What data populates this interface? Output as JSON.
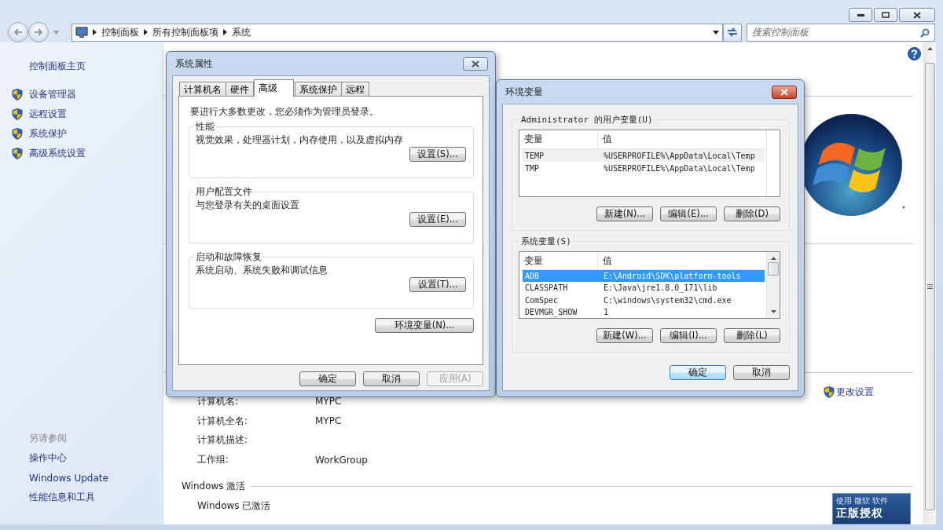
{
  "address_bar": {
    "crumbs": [
      "控制面板",
      "所有控制面板项",
      "系统"
    ]
  },
  "search": {
    "placeholder": "搜索控制面板"
  },
  "sidebar": {
    "home": "控制面板主页",
    "items": [
      {
        "label": "设备管理器"
      },
      {
        "label": "远程设置"
      },
      {
        "label": "系统保护"
      },
      {
        "label": "高级系统设置"
      }
    ],
    "see_also": {
      "title": "另请参阅",
      "links": [
        "操作中心",
        "Windows Update",
        "性能信息和工具"
      ]
    }
  },
  "computer": {
    "change_settings": "更改设置",
    "rows": [
      {
        "label": "计算机名:",
        "value": "MYPC"
      },
      {
        "label": "计算机全名:",
        "value": "MYPC"
      },
      {
        "label": "计算机描述:"
      },
      {
        "label": "工作组:",
        "value": "WorkGroup"
      }
    ]
  },
  "activation": {
    "title": "Windows 激活",
    "status": "Windows 已激活",
    "badge": {
      "small": [
        "使用",
        "微软",
        "软件"
      ],
      "main": "正版授权"
    }
  },
  "system_properties": {
    "title": "系统属性",
    "tabs": [
      {
        "label": "计算机名",
        "selected": false
      },
      {
        "label": "硬件",
        "selected": false
      },
      {
        "label": "高级",
        "selected": true
      },
      {
        "label": "系统保护",
        "selected": false
      },
      {
        "label": "远程",
        "selected": false
      }
    ],
    "notice": "要进行大多数更改，您必须作为管理员登录。",
    "groups": [
      {
        "title": "性能",
        "description": "视觉效果，处理器计划，内存使用，以及虚拟内存",
        "button": "设置(S)..."
      },
      {
        "title": "用户配置文件",
        "description": "与您登录有关的桌面设置",
        "button": "设置(E)..."
      },
      {
        "title": "启动和故障恢复",
        "description": "系统启动、系统失败和调试信息",
        "button": "设置(T)..."
      }
    ],
    "env_button": "环境变量(N)...",
    "buttons": [
      {
        "label": "确定",
        "disabled": false
      },
      {
        "label": "取消",
        "disabled": false
      },
      {
        "label": "应用(A)",
        "disabled": true
      }
    ]
  },
  "environment_variables": {
    "title": "环境变量",
    "lists": [
      {
        "title": "Administrator 的用户变量(U)",
        "focused": false,
        "columns": [
          "变量",
          "值"
        ],
        "rows": [
          {
            "name": "TEMP",
            "value": "%USERPROFILE%\\AppData\\Local\\Temp",
            "selected": true
          },
          {
            "name": "TMP",
            "value": "%USERPROFILE%\\AppData\\Local\\Temp",
            "selected": false
          }
        ],
        "buttons": [
          "新建(N)...",
          "编辑(E)...",
          "删除(D)"
        ]
      },
      {
        "title": "系统变量(S)",
        "focused": true,
        "columns": [
          "变量",
          "值"
        ],
        "rows": [
          {
            "name": "ADB",
            "value": "E:\\Android\\SDK\\platform-tools",
            "selected": true
          },
          {
            "name": "CLASSPATH",
            "value": "E:\\Java\\jre1.8.0_171\\lib",
            "selected": false
          },
          {
            "name": "ComSpec",
            "value": "C:\\windows\\system32\\cmd.exe",
            "selected": false
          },
          {
            "name": "DEVMGR_SHOW",
            "value": "1",
            "selected": false
          }
        ],
        "buttons": [
          "新建(W)...",
          "编辑(I)...",
          "删除(L)"
        ]
      }
    ],
    "buttons": [
      {
        "label": "确定",
        "default": true
      },
      {
        "label": "取消",
        "default": false
      }
    ]
  }
}
